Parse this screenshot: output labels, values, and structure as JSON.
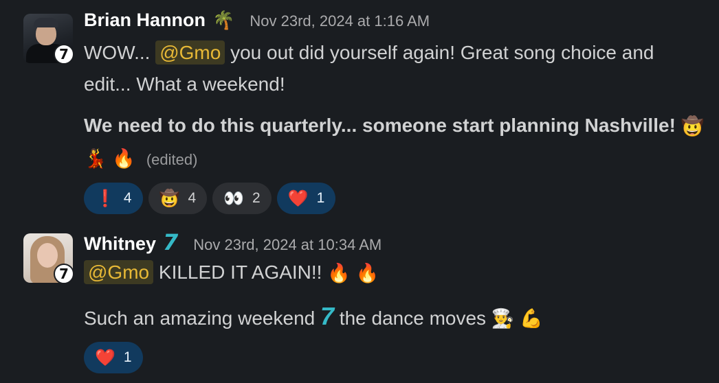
{
  "messages": [
    {
      "author": "Brian Hannon",
      "status_emoji": "🌴",
      "timestamp": "Nov 23rd, 2024 at 1:16 AM",
      "avatar_badge": "7",
      "line1_before": "WOW... ",
      "mention": "@Gmo",
      "line1_after": " you out did yourself again! Great song choice and",
      "line2": "edit... What a weekend!",
      "line3": "We need to do this quarterly... someone start planning Nashville!",
      "edited": "(edited)",
      "emojis": {
        "cowboy": "🤠",
        "dancer": "💃",
        "fire": "🔥"
      },
      "reactions": [
        {
          "emoji": "❗",
          "count": "4",
          "active": true,
          "icon": "exclamation-icon"
        },
        {
          "emoji": "🤠",
          "count": "4",
          "active": false,
          "icon": "cowboy-icon"
        },
        {
          "emoji": "👀",
          "count": "2",
          "active": false,
          "icon": "eyes-icon"
        },
        {
          "emoji": "❤️",
          "count": "1",
          "active": true,
          "icon": "heart-icon"
        }
      ]
    },
    {
      "author": "Whitney",
      "status_emoji": "7",
      "timestamp": "Nov 23rd, 2024 at 10:34 AM",
      "avatar_badge": "7",
      "mention": "@Gmo",
      "line1_after": " KILLED IT AGAIN!! ",
      "line2_before": "Such an amazing weekend ",
      "line2_seven": "7",
      "line2_after": " the dance moves ",
      "emojis": {
        "fire": "🔥",
        "chef": "👨‍🍳",
        "muscle": "💪"
      },
      "reactions": [
        {
          "emoji": "❤️",
          "count": "1",
          "active": true,
          "icon": "heart-icon"
        }
      ]
    }
  ],
  "colors": {
    "background": "#1a1d21",
    "mention_text": "#e8b936",
    "mention_bg": "#3d3a22",
    "reaction_active_bg": "#113a5e",
    "reaction_bg": "#2d2f33",
    "seven_accent": "#35b9c7"
  }
}
